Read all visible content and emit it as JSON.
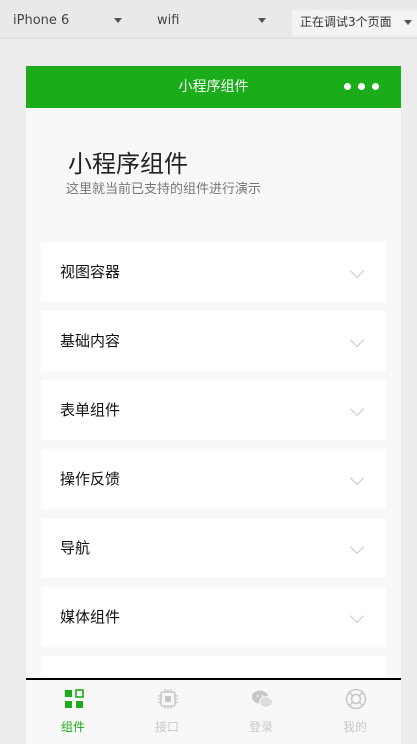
{
  "toolbar": {
    "device": "iPhone 6",
    "network": "wifi",
    "debug_status": "正在调试3个页面"
  },
  "navbar": {
    "title": "小程序组件",
    "background_color": "#1aad19"
  },
  "header": {
    "title": "小程序组件",
    "description": "这里就当前已支持的组件进行演示"
  },
  "list": {
    "items": [
      {
        "label": "视图容器"
      },
      {
        "label": "基础内容"
      },
      {
        "label": "表单组件"
      },
      {
        "label": "操作反馈"
      },
      {
        "label": "导航"
      },
      {
        "label": "媒体组件"
      }
    ]
  },
  "tabbar": {
    "active_color": "#1aad19",
    "inactive_color": "#c8c8c8",
    "tabs": [
      {
        "label": "组件",
        "icon": "grid-icon",
        "active": true
      },
      {
        "label": "接口",
        "icon": "chip-icon",
        "active": false
      },
      {
        "label": "登录",
        "icon": "wechat-icon",
        "active": false
      },
      {
        "label": "我的",
        "icon": "lifebuoy-icon",
        "active": false
      }
    ]
  }
}
